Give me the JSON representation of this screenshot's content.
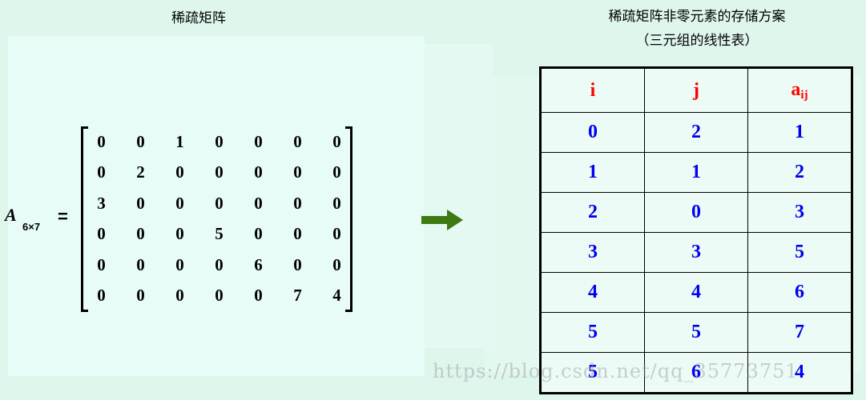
{
  "left_title": "稀疏矩阵",
  "right_title_line1": "稀疏矩阵非零元素的存储方案",
  "right_title_line2": "（三元组的线性表）",
  "matrix_label": {
    "name": "A",
    "subscript": "6×7",
    "equals": "="
  },
  "matrix": [
    [
      "0",
      "0",
      "1",
      "0",
      "0",
      "0",
      "0"
    ],
    [
      "0",
      "2",
      "0",
      "0",
      "0",
      "0",
      "0"
    ],
    [
      "3",
      "0",
      "0",
      "0",
      "0",
      "0",
      "0"
    ],
    [
      "0",
      "0",
      "0",
      "5",
      "0",
      "0",
      "0"
    ],
    [
      "0",
      "0",
      "0",
      "0",
      "6",
      "0",
      "0"
    ],
    [
      "0",
      "0",
      "0",
      "0",
      "0",
      "7",
      "4"
    ]
  ],
  "table": {
    "headers": {
      "i": "i",
      "j": "j",
      "a": "a",
      "a_sub": "ij"
    },
    "rows": [
      [
        "0",
        "2",
        "1"
      ],
      [
        "1",
        "1",
        "2"
      ],
      [
        "2",
        "0",
        "3"
      ],
      [
        "3",
        "3",
        "5"
      ],
      [
        "4",
        "4",
        "6"
      ],
      [
        "5",
        "5",
        "7"
      ],
      [
        "5",
        "6",
        "4"
      ]
    ]
  },
  "watermark": "https://blog.csdn.net/qq_35773751",
  "colors": {
    "header": "#ff0000",
    "values": "#0000ee",
    "arrow": "#3d7a12",
    "background": "#dff6ed"
  },
  "icons": {
    "arrow": "right-arrow-icon"
  }
}
